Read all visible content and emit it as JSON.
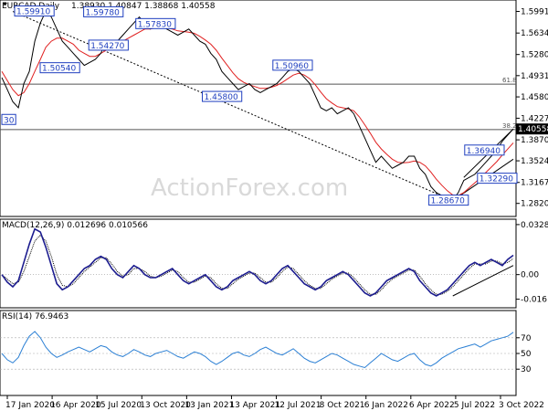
{
  "chart_data": [
    {
      "type": "line",
      "panel": "price",
      "title": "EURCAD,Daily",
      "ohlc_header": "1.38930 1.40847 1.38868 1.40558",
      "last_price_label": "1.40558",
      "ylim": [
        1.265,
        1.612
      ],
      "y_ticks": [
        "1.59915",
        "1.56345",
        "1.52800",
        "1.49310",
        "1.45800",
        "1.42275",
        "1.38705",
        "1.35240",
        "1.31670",
        "1.28205"
      ],
      "y_tick_values": [
        1.59915,
        1.56345,
        1.528,
        1.4931,
        1.458,
        1.42275,
        1.38705,
        1.3524,
        1.3167,
        1.28205
      ],
      "fib_levels": [
        {
          "label": "61.8",
          "value": 1.479
        },
        {
          "label": "38.2",
          "value": 1.404
        }
      ],
      "price_labels": [
        {
          "text": "1.59910",
          "x": 0.025,
          "y": 1.5991
        },
        {
          "text": "1.59780",
          "x": 0.16,
          "y": 1.5978
        },
        {
          "text": "1.57830",
          "x": 0.262,
          "y": 1.5783
        },
        {
          "text": "1.54270",
          "x": 0.17,
          "y": 1.5427
        },
        {
          "text": "1.50540",
          "x": 0.075,
          "y": 1.5054
        },
        {
          "text": "1.50960",
          "x": 0.53,
          "y": 1.5096
        },
        {
          "text": "1.45800",
          "x": 0.392,
          "y": 1.458
        },
        {
          "text": "1.36940",
          "x": 0.905,
          "y": 1.3694
        },
        {
          "text": "1.32290",
          "x": 0.93,
          "y": 1.3229
        },
        {
          "text": "1.28670",
          "x": 0.835,
          "y": 1.2867
        },
        {
          "text": "30",
          "x": 0.0,
          "y": 1.42
        }
      ],
      "series": [
        {
          "name": "price",
          "values": [
            1.49,
            1.47,
            1.45,
            1.44,
            1.48,
            1.5,
            1.55,
            1.58,
            1.6,
            1.59,
            1.57,
            1.55,
            1.54,
            1.53,
            1.52,
            1.51,
            1.515,
            1.52,
            1.53,
            1.55,
            1.54,
            1.55,
            1.56,
            1.57,
            1.58,
            1.59,
            1.58,
            1.57,
            1.575,
            1.578,
            1.57,
            1.565,
            1.56,
            1.565,
            1.57,
            1.56,
            1.55,
            1.545,
            1.53,
            1.52,
            1.5,
            1.49,
            1.48,
            1.47,
            1.475,
            1.48,
            1.47,
            1.465,
            1.47,
            1.475,
            1.48,
            1.49,
            1.5,
            1.505,
            1.5,
            1.49,
            1.48,
            1.46,
            1.44,
            1.435,
            1.44,
            1.43,
            1.435,
            1.44,
            1.43,
            1.41,
            1.39,
            1.37,
            1.35,
            1.36,
            1.35,
            1.34,
            1.345,
            1.35,
            1.36,
            1.36,
            1.34,
            1.33,
            1.31,
            1.3,
            1.295,
            1.29,
            1.287,
            1.3,
            1.32,
            1.325,
            1.33,
            1.34,
            1.35,
            1.36,
            1.37,
            1.385,
            1.395,
            1.405
          ]
        },
        {
          "name": "sma",
          "values": [
            1.5,
            1.485,
            1.47,
            1.46,
            1.465,
            1.48,
            1.5,
            1.52,
            1.54,
            1.55,
            1.555,
            1.555,
            1.55,
            1.545,
            1.535,
            1.53,
            1.525,
            1.525,
            1.53,
            1.535,
            1.54,
            1.545,
            1.55,
            1.555,
            1.56,
            1.565,
            1.57,
            1.57,
            1.572,
            1.573,
            1.572,
            1.57,
            1.567,
            1.566,
            1.565,
            1.563,
            1.558,
            1.552,
            1.545,
            1.535,
            1.522,
            1.51,
            1.498,
            1.488,
            1.482,
            1.478,
            1.475,
            1.472,
            1.472,
            1.474,
            1.477,
            1.482,
            1.488,
            1.494,
            1.497,
            1.494,
            1.488,
            1.478,
            1.466,
            1.455,
            1.448,
            1.442,
            1.44,
            1.438,
            1.435,
            1.425,
            1.412,
            1.398,
            1.383,
            1.372,
            1.363,
            1.355,
            1.35,
            1.349,
            1.35,
            1.352,
            1.35,
            1.344,
            1.334,
            1.322,
            1.312,
            1.303,
            1.296,
            1.295,
            1.3,
            1.308,
            1.316,
            1.324,
            1.333,
            1.342,
            1.351,
            1.362,
            1.372,
            1.382
          ]
        }
      ],
      "x_ticks": [
        "17 Jan 2020",
        "16 Apr 2020",
        "15 Jul 2020",
        "13 Oct 2020",
        "13 Jan 2021",
        "13 Apr 2021",
        "12 Jul 2021",
        "8 Oct 2021",
        "6 Jan 2022",
        "6 Apr 2022",
        "5 Jul 2022",
        "3 Oct 2022"
      ]
    },
    {
      "type": "line",
      "panel": "macd",
      "title": "MACD(12,26,9) 0.012696 0.010566",
      "ylim": [
        -0.02,
        0.034
      ],
      "y_ticks": [
        "0.03286",
        "0.00",
        "-0.016151"
      ],
      "y_tick_values": [
        0.03286,
        0.0,
        -0.016151
      ],
      "series": [
        {
          "name": "macd",
          "values": [
            0.0,
            -0.005,
            -0.008,
            -0.004,
            0.008,
            0.02,
            0.03,
            0.028,
            0.018,
            0.006,
            -0.006,
            -0.01,
            -0.008,
            -0.004,
            0.0,
            0.004,
            0.006,
            0.01,
            0.012,
            0.01,
            0.004,
            0.0,
            -0.002,
            0.002,
            0.006,
            0.004,
            0.0,
            -0.002,
            -0.002,
            0.0,
            0.002,
            0.004,
            0.0,
            -0.004,
            -0.006,
            -0.004,
            -0.002,
            0.0,
            -0.004,
            -0.008,
            -0.01,
            -0.008,
            -0.004,
            -0.002,
            0.0,
            0.002,
            0.0,
            -0.004,
            -0.006,
            -0.004,
            0.0,
            0.004,
            0.006,
            0.002,
            -0.002,
            -0.006,
            -0.008,
            -0.01,
            -0.008,
            -0.004,
            -0.002,
            0.0,
            0.002,
            0.0,
            -0.004,
            -0.008,
            -0.012,
            -0.014,
            -0.012,
            -0.008,
            -0.004,
            -0.002,
            0.0,
            0.002,
            0.004,
            0.002,
            -0.004,
            -0.008,
            -0.012,
            -0.014,
            -0.012,
            -0.01,
            -0.006,
            -0.002,
            0.002,
            0.006,
            0.008,
            0.006,
            0.008,
            0.01,
            0.008,
            0.006,
            0.01,
            0.0127
          ]
        },
        {
          "name": "signal",
          "values": [
            0.0,
            -0.003,
            -0.006,
            -0.005,
            0.002,
            0.012,
            0.022,
            0.026,
            0.022,
            0.012,
            0.0,
            -0.007,
            -0.008,
            -0.006,
            -0.002,
            0.002,
            0.005,
            0.008,
            0.011,
            0.011,
            0.007,
            0.002,
            -0.001,
            0.0,
            0.004,
            0.004,
            0.002,
            -0.001,
            -0.002,
            -0.001,
            0.001,
            0.003,
            0.002,
            -0.002,
            -0.005,
            -0.005,
            -0.003,
            -0.001,
            -0.002,
            -0.006,
            -0.009,
            -0.009,
            -0.006,
            -0.003,
            -0.001,
            0.001,
            0.001,
            -0.002,
            -0.005,
            -0.005,
            -0.002,
            0.002,
            0.005,
            0.004,
            0.0,
            -0.004,
            -0.007,
            -0.009,
            -0.009,
            -0.006,
            -0.003,
            -0.001,
            0.001,
            0.001,
            -0.002,
            -0.006,
            -0.01,
            -0.013,
            -0.013,
            -0.01,
            -0.006,
            -0.003,
            -0.001,
            0.001,
            0.003,
            0.003,
            -0.001,
            -0.006,
            -0.01,
            -0.013,
            -0.013,
            -0.011,
            -0.008,
            -0.004,
            0.0,
            0.004,
            0.007,
            0.007,
            0.007,
            0.009,
            0.009,
            0.007,
            0.008,
            0.0106
          ]
        }
      ]
    },
    {
      "type": "line",
      "panel": "rsi",
      "title": "RSI(14) 76.9463",
      "ylim": [
        0,
        100
      ],
      "y_ticks": [
        "70",
        "50",
        "30"
      ],
      "y_tick_values": [
        70,
        50,
        30
      ],
      "series": [
        {
          "name": "rsi",
          "values": [
            50,
            42,
            38,
            45,
            60,
            72,
            78,
            70,
            58,
            50,
            45,
            48,
            52,
            55,
            58,
            55,
            52,
            56,
            60,
            58,
            52,
            48,
            46,
            50,
            55,
            52,
            48,
            46,
            50,
            52,
            54,
            50,
            46,
            44,
            48,
            52,
            50,
            46,
            40,
            36,
            40,
            45,
            50,
            52,
            48,
            46,
            50,
            55,
            58,
            54,
            50,
            48,
            52,
            56,
            50,
            44,
            40,
            38,
            42,
            46,
            50,
            48,
            44,
            40,
            36,
            34,
            32,
            38,
            44,
            50,
            46,
            42,
            40,
            44,
            48,
            50,
            42,
            36,
            34,
            38,
            44,
            48,
            52,
            56,
            58,
            60,
            62,
            58,
            62,
            66,
            68,
            70,
            72,
            77
          ]
        }
      ]
    }
  ],
  "watermark": "ActionForex.com"
}
